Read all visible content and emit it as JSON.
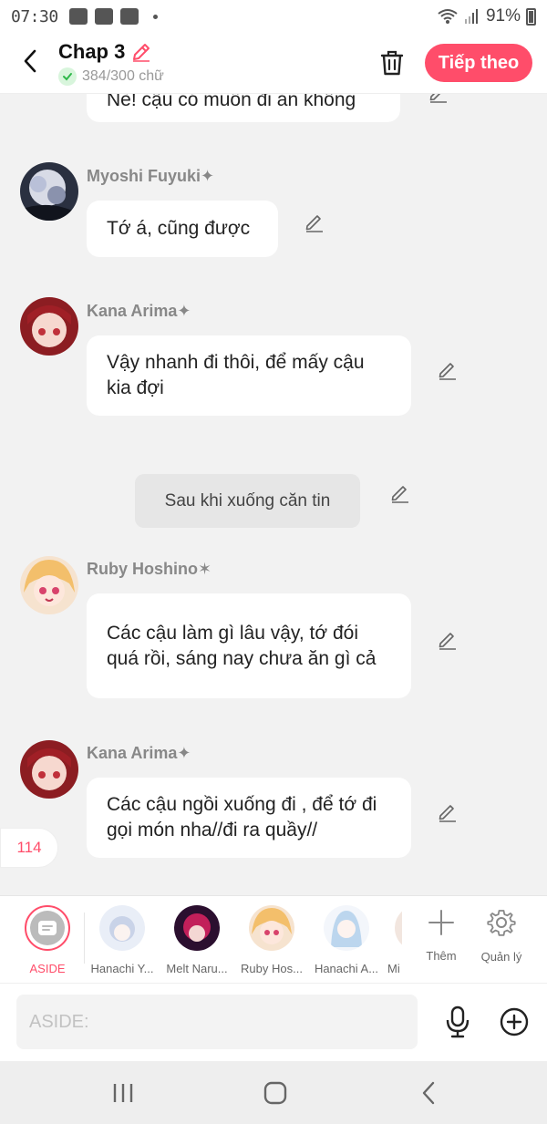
{
  "status_bar": {
    "time": "07:30",
    "battery": "91%"
  },
  "header": {
    "title": "Chap 3",
    "word_count": "384/300 chữ",
    "next_label": "Tiếp theo"
  },
  "chat": {
    "top_partial_text": "Nè! cậu có muốn đi ăn không",
    "messages": [
      {
        "name": "Myoshi Fuyuki",
        "mark": "✦",
        "text": "Tớ á, cũng được"
      },
      {
        "name": "Kana Arima",
        "mark": "✦",
        "text": "Vậy nhanh đi thôi, để mấy cậu kia đợi"
      },
      {
        "name": "Ruby Hoshino",
        "mark": "✶",
        "text": "Các cậu làm gì lâu vậy, tớ đói quá rồi, sáng nay chưa ăn gì cả"
      },
      {
        "name": "Kana Arima",
        "mark": "✦",
        "text": "Các cậu ngồi xuống đi , để tớ đi gọi món nha//đi ra quầy//"
      }
    ],
    "narration": "Sau khi xuống căn tin",
    "count_badge": "114"
  },
  "characters": {
    "items": [
      {
        "label": "ASIDE"
      },
      {
        "label": "Hanachi Y..."
      },
      {
        "label": "Melt Naru..."
      },
      {
        "label": "Ruby Hos..."
      },
      {
        "label": "Hanachi A..."
      },
      {
        "label": "Mi"
      }
    ],
    "add_label": "Thêm",
    "manage_label": "Quản lý"
  },
  "input": {
    "placeholder": "ASIDE:"
  },
  "colors": {
    "accent": "#ff4d6a",
    "background": "#f2f2f2"
  }
}
